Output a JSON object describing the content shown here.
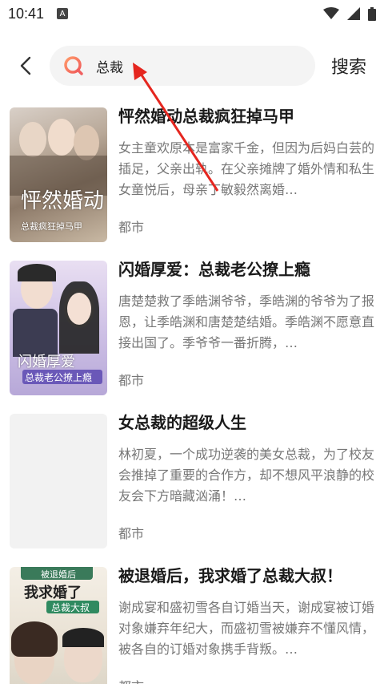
{
  "status_bar": {
    "time": "10:41",
    "notif_badge": "A"
  },
  "header": {
    "search_query": "总裁",
    "search_button": "搜索"
  },
  "results": [
    {
      "title": "怦然婚动总裁疯狂掉马甲",
      "description": "女主童欢原本是富家千金，但因为后妈白芸的插足，父亲出轨。在父亲摊牌了婚外情和私生女童悦后，母亲丁敏毅然离婚…",
      "genre": "都市",
      "cover_text": "怦然婚动",
      "cover_subtext": "总裁疯狂掉马甲"
    },
    {
      "title": "闪婚厚爱：总裁老公撩上瘾",
      "description": "唐楚楚救了季皓渊爷爷，季皓渊的爷爷为了报恩，让季皓渊和唐楚楚结婚。季皓渊不愿意直接出国了。季爷爷一番折腾，…",
      "genre": "都市",
      "cover_text": "闪婚厚爱",
      "cover_subtext": "总裁老公撩上瘾"
    },
    {
      "title": "女总裁的超级人生",
      "description": "林初夏，一个成功逆袭的美女总裁，为了校友会推掉了重要的合作方，却不想风平浪静的校友会下方暗藏汹涌！…",
      "genre": "都市"
    },
    {
      "title": "被退婚后，我求婚了总裁大叔！",
      "description": "谢成宴和盛初雪各自订婚当天，谢成宴被订婚对象嫌弃年纪大，而盛初雪被嫌弃不懂风情，被各自的订婚对象携手背叛。…",
      "genre": "都市",
      "cover_text": "我求婚了",
      "cover_subtext": "总裁大叔",
      "cover_toptext": "被退婚后"
    }
  ]
}
